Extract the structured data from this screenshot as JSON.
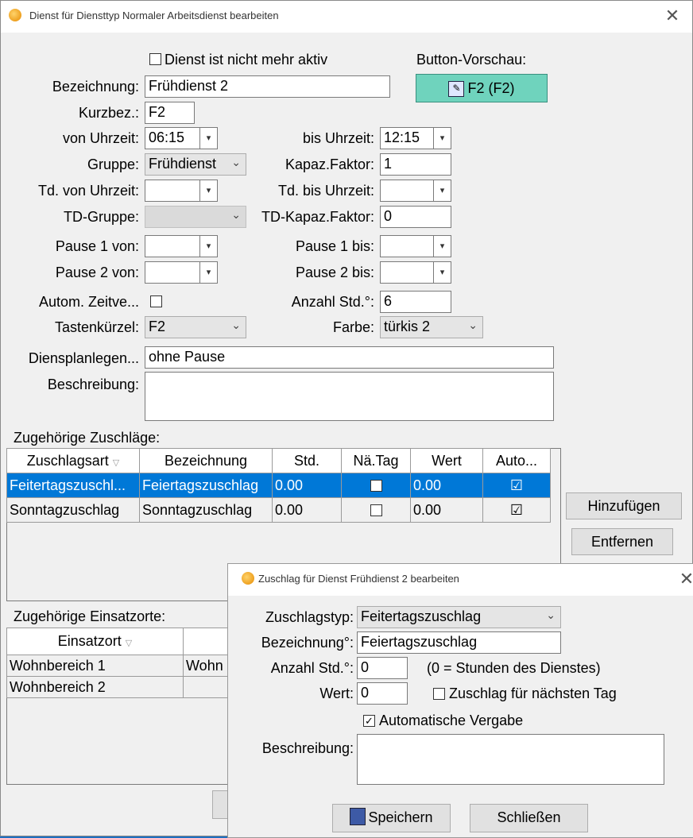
{
  "main": {
    "title": "Dienst für Diensttyp Normaler Arbeitsdienst bearbeiten",
    "inactive_label": "Dienst ist nicht mehr aktiv",
    "preview_label": "Button-Vorschau:",
    "preview_button": "F2 (F2)",
    "preview_color": "#6fd3bd",
    "bezeichnung_label": "Bezeichnung:",
    "bezeichnung_value": "Frühdienst 2",
    "kurzbez_label": "Kurzbez.:",
    "kurzbez_value": "F2",
    "von_label": "von Uhrzeit:",
    "von_value": "06:15",
    "bis_label": "bis Uhrzeit:",
    "bis_value": "12:15",
    "gruppe_label": "Gruppe:",
    "gruppe_value": "Frühdienst",
    "kapaz_label": "Kapaz.Faktor:",
    "kapaz_value": "1",
    "td_von_label": "Td. von Uhrzeit:",
    "td_bis_label": "Td. bis Uhrzeit:",
    "tdgruppe_label": "TD-Gruppe:",
    "tdkapaz_label": "TD-Kapaz.Faktor:",
    "tdkapaz_value": "0",
    "p1von_label": "Pause 1 von:",
    "p1bis_label": "Pause 1 bis:",
    "p2von_label": "Pause 2 von:",
    "p2bis_label": "Pause 2 bis:",
    "autom_label": "Autom. Zeitve...",
    "anzahl_label": "Anzahl Std.°:",
    "anzahl_value": "6",
    "tasten_label": "Tastenkürzel:",
    "tasten_value": "F2",
    "farbe_label": "Farbe:",
    "farbe_value": "türkis 2",
    "legende_label": "Diensplanlegen...",
    "legende_value": "ohne Pause",
    "beschreibung_label": "Beschreibung:",
    "zuschlaege_label": "Zugehörige Zuschläge:",
    "zuschlaege_headers": [
      "Zuschlagsart",
      "Bezeichnung",
      "Std.",
      "Nä.Tag",
      "Wert",
      "Auto..."
    ],
    "zuschlaege_rows": [
      [
        "Feitertagszuschl...",
        "Feiertagszuschlag",
        "0.00",
        "",
        "0.00",
        "☑"
      ],
      [
        "Sonntagzuschlag",
        "Sonntagzuschlag",
        "0.00",
        "",
        "0.00",
        "☑"
      ]
    ],
    "add_button": "Hinzufügen",
    "remove_button": "Entfernen",
    "einsatz_label": "Zugehörige Einsatzorte:",
    "einsatz_headers": [
      "Einsatzort",
      ""
    ],
    "einsatz_rows": [
      [
        "Wohnbereich 1",
        "Wohn"
      ],
      [
        "Wohnbereich 2",
        ""
      ]
    ]
  },
  "dialog": {
    "title": "Zuschlag für Dienst Frühdienst 2 bearbeiten",
    "typ_label": "Zuschlagstyp:",
    "typ_value": "Feitertagszuschlag",
    "bez_label": "Bezeichnung°:",
    "bez_value": "Feiertagszuschlag",
    "anzahl_label": "Anzahl Std.°:",
    "anzahl_value": "0",
    "anzahl_hint": "(0 = Stunden des Dienstes)",
    "wert_label": "Wert:",
    "wert_value": "0",
    "next_day_label": "Zuschlag für nächsten Tag",
    "auto_label": "Automatische Vergabe",
    "beschreibung_label": "Beschreibung:",
    "save_button": "Speichern",
    "close_button": "Schließen"
  }
}
